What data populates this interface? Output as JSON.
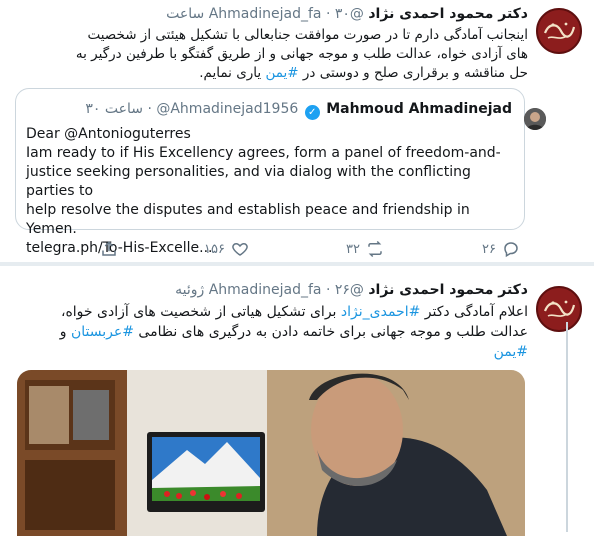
{
  "tweet1": {
    "author_name": "دکتر محمود احمدی نژاد",
    "handle": "@Ahmadinejad_fa",
    "time": "۳۰ ساعت",
    "text_line1": "اینجانب آمادگی دارم تا در صورت موافقت جنابعالی با تشکیل هیئتی از شخصیت",
    "text_line2": "های آزادی خواه، عدالت طلب و موجه جهانی و از طریق گفتگو با طرفین درگیر به",
    "text_line3_pre": "حل مناقشه و برقراری صلح و دوستی در ",
    "text_line3_hashtag": "#یمن",
    "text_line3_post": " یاری نمایم.",
    "quote": {
      "name": "Mahmoud Ahmadinejad",
      "handle": "@Ahmadinejad1956",
      "time": "۳۰ ساعت",
      "line1": "Dear @Antonioguterres",
      "line2": "Iam ready to if His Excellency agrees, form a panel of freedom-and-",
      "line3": "justice seeking personalities, and via dialog with the conflicting parties to",
      "line4": "help resolve the disputes and establish peace and friendship in Yemen.",
      "line5": "telegra.ph/To-His-Excelle..."
    },
    "actions": {
      "replies": "۲۶",
      "retweets": "۳۲",
      "likes": "۱۵۶"
    }
  },
  "tweet2": {
    "author_name": "دکتر محمود احمدی نژاد",
    "handle": "@Ahmadinejad_fa",
    "time": "۲۶ ژوئیه",
    "line1_pre": "اعلام آمادگی دکتر ",
    "line1_hashtag": "#احمدی_نژاد",
    "line1_post": " برای تشکیل هیاتی از شخصیت های آزادی خواه،",
    "line2_pre": "عدالت طلب و موجه جهانی برای خاتمه دادن به درگیری های نظامی ",
    "line2_hashtag": "#عربستان",
    "line2_post": " و",
    "line3_hashtag": "#یمن"
  },
  "colors": {
    "link": "#1b95e0",
    "secondary_text": "#657786",
    "border": "#ccd6dd",
    "avatar_bg": "#8c1d1d"
  }
}
